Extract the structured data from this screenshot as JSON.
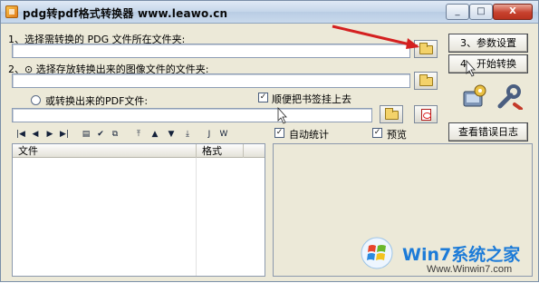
{
  "window": {
    "title": "pdg转pdf格式转换器 www.leawo.cn",
    "controls": {
      "minimize": "_",
      "maximize": "□",
      "close": "X"
    }
  },
  "step1": {
    "label": "1、选择需转换的 PDG 文件所在文件夹:",
    "path_value": ""
  },
  "step2": {
    "label": "2、⊙ 选择存放转换出来的图像文件的文件夹:",
    "path_value": ""
  },
  "step2b": {
    "label": "或转换出来的PDF文件:",
    "path_value": ""
  },
  "options": {
    "bookmark": {
      "label": "顺便把书签挂上去",
      "checked": true
    },
    "auto_stats": {
      "label": "自动统计",
      "checked": true
    },
    "preview": {
      "label": "预览",
      "checked": true
    }
  },
  "buttons": {
    "settings": "3、参数设置",
    "start": "4、开始转换",
    "view_log": "查看错误日志"
  },
  "toolbar": {
    "icons": [
      "first-icon",
      "prev-icon",
      "next-icon",
      "last-icon",
      "page-icon",
      "check-icon",
      "copy-icon",
      "top-icon",
      "up-icon",
      "down-icon",
      "bottom-icon",
      "j-icon",
      "w-icon"
    ],
    "glyphs": [
      "|◀",
      "◀",
      "▶",
      "▶|",
      "▤",
      "✔",
      "⧉",
      "⤒",
      "▲",
      "▼",
      "⤓",
      "J",
      "W"
    ]
  },
  "list": {
    "columns": [
      "文件",
      "格式"
    ]
  },
  "watermark": {
    "brand": "Win7系统之家",
    "url": "Www.Winwin7.com"
  },
  "colors": {
    "accent_arrow": "#d42020",
    "title_bg": "#c5d6ea",
    "watermark_blue": "#1c7bd8"
  }
}
